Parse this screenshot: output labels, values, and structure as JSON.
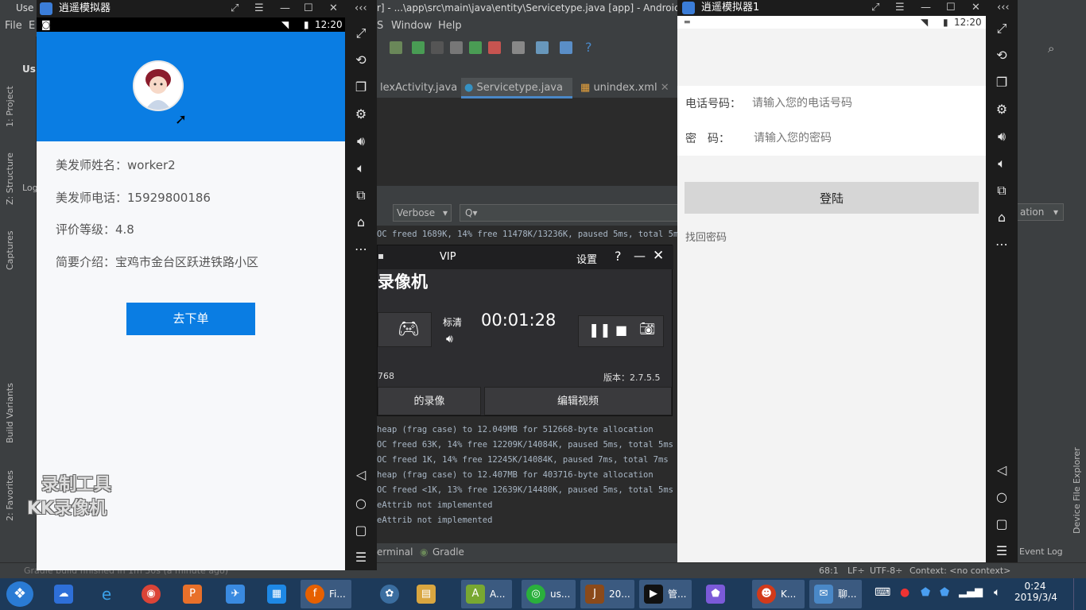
{
  "ide": {
    "title_left": "Use",
    "title": "r] - ...\\app\\src\\main\\java\\entity\\Servicetype.java [app] - Android S",
    "menu": [
      "File",
      "E",
      "S",
      "Window",
      "Help"
    ],
    "tabs": [
      "lexActivity.java",
      "Servicetype.java",
      "unindex.xml"
    ],
    "logcat_level": "Verbose",
    "logcat_search_placeholder": "Q▾",
    "log_lines": [
      "OC freed 1689K, 14% free 11478K/13236K, paused 5ms, total 5ms",
      "heap (frag case) to 12.049MB for 512668-byte allocation",
      "OC freed 63K, 14% free 12209K/14084K, paused 5ms, total 5ms",
      "OC freed 1K, 14% free 12245K/14084K, paused 7ms, total 7ms",
      "heap (frag case) to 12.407MB for 403716-byte allocation",
      "OC freed <1K, 13% free 12639K/14480K, paused 5ms, total 5ms",
      "eAttrib not implemented",
      "eAttrib not implemented"
    ],
    "bottom_tools": [
      "erminal",
      "Gradle"
    ],
    "left_labels": [
      "1: Project",
      "Z: Structure",
      "Captures",
      "Build Variants",
      "2: Favorites"
    ],
    "left_top_label": "Us",
    "log_label": "Log",
    "right_dropdown": "ation",
    "right_labels": [
      "Device File Explorer",
      "Event Log"
    ],
    "status_left": "Gradle build finished in 1m 30s (a minute ago)",
    "status_right": [
      "68:1",
      "LF÷",
      "UTF-8÷",
      "Context: <no context>"
    ]
  },
  "emulator1": {
    "title": "逍遥模拟器",
    "time": "12:20",
    "info": [
      "美发师姓名：worker2",
      "美发师电话：15929800186",
      "评价等级：4.8",
      "简要介绍：宝鸡市金台区跃进铁路小区"
    ],
    "order_button": "去下单"
  },
  "recorder": {
    "vip": "VIP",
    "settings": "设置",
    "help": "?",
    "app_name": "录像机",
    "quality": "标清",
    "timer": "00:01:28",
    "resolution": "768",
    "version": "版本：2.7.5.5",
    "btn_left": "的录像",
    "btn_right": "编辑视频"
  },
  "watermark": [
    "录制工具",
    "KK录像机"
  ],
  "emulator2": {
    "title": "逍遥模拟器1",
    "time": "12:20",
    "phone_label": "电话号码：",
    "phone_placeholder": "请输入您的电话号码",
    "password_label": "密　码：",
    "password_placeholder": "请输入您的密码",
    "login_button": "登陆",
    "forgot": "找回密码"
  },
  "taskbar": {
    "items": [
      {
        "label": "Fi...",
        "color": "#e66000"
      },
      {
        "label": "A...",
        "color": "#78a832"
      },
      {
        "label": "us...",
        "color": "#2ab03c"
      },
      {
        "label": "20...",
        "color": "#8b4a1a"
      },
      {
        "label": "管...",
        "color": "#111111"
      },
      {
        "label": "K...",
        "color": "#d23a1a"
      },
      {
        "label": "聊...",
        "color": "#4a88c7"
      }
    ],
    "time": "0:24",
    "date": "2019/3/4"
  }
}
